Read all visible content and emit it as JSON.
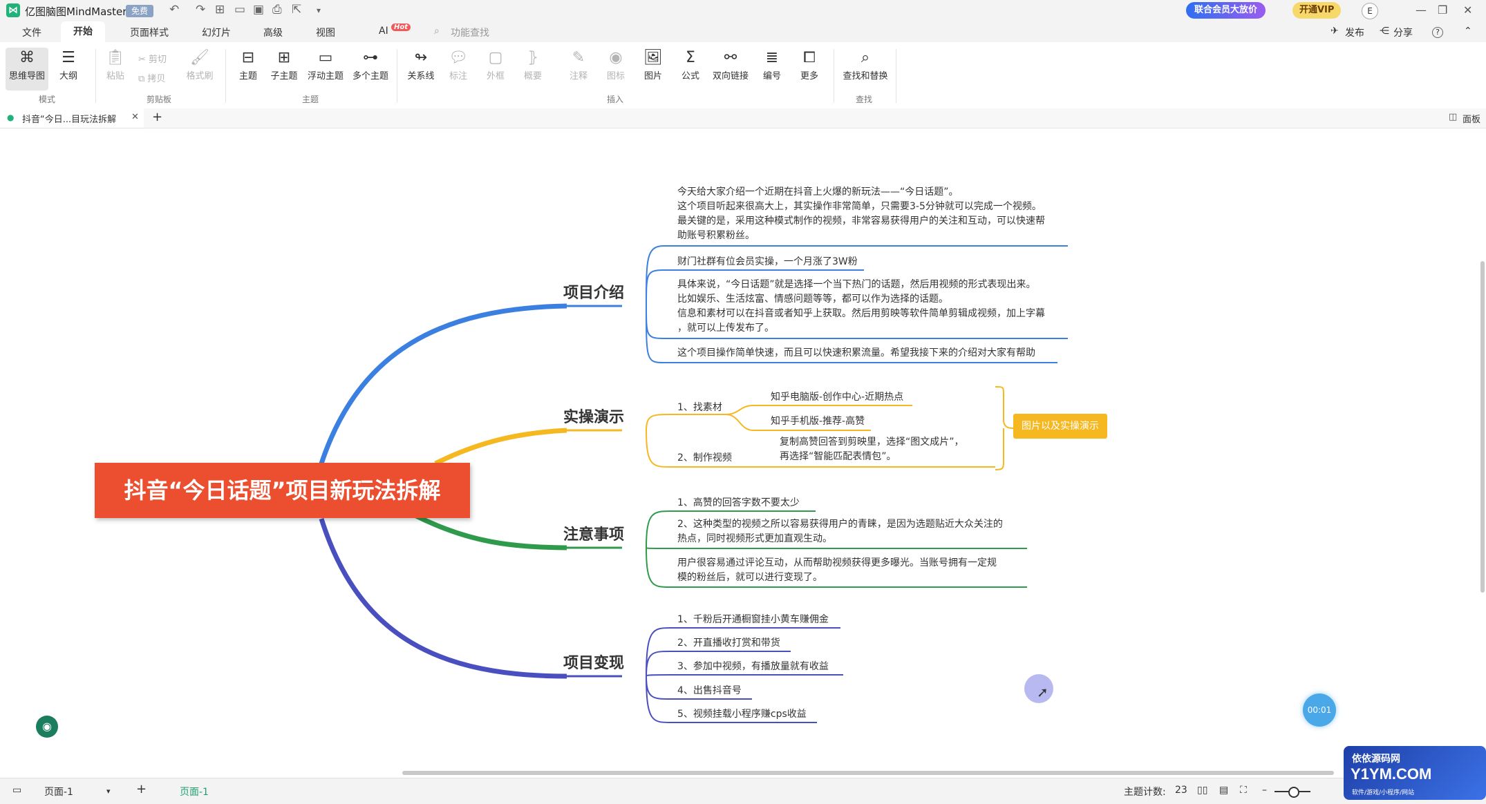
{
  "app": {
    "name": "亿图脑图MindMaster",
    "badge": "免费",
    "search_placeholder": "功能查找",
    "promo": "联合会员大放价",
    "vip": "开通VIP",
    "avatar": "E"
  },
  "menu": {
    "items": [
      "文件",
      "开始",
      "页面样式",
      "幻灯片",
      "高级",
      "视图",
      "AI"
    ],
    "active": "开始",
    "hot": "Hot",
    "publish": "发布",
    "share": "分享",
    "help": "?"
  },
  "ribbon": {
    "mode": [
      "思维导图",
      "大纲"
    ],
    "clipboard": [
      "粘贴",
      "剪切",
      "拷贝",
      "格式刷"
    ],
    "topic": [
      "主题",
      "子主题",
      "浮动主题",
      "多个主题"
    ],
    "insert": [
      "关系线",
      "标注",
      "外框",
      "概要",
      "注释",
      "图标",
      "图片",
      "公式",
      "双向链接",
      "编号",
      "更多"
    ],
    "find": [
      "查找和替换"
    ],
    "group_labels": [
      "模式",
      "剪贴板",
      "主题",
      "插入",
      "查找"
    ]
  },
  "tabs": {
    "doc_tab": "抖音“今日...目玩法拆解",
    "panel": "面板"
  },
  "mindmap": {
    "central": "抖音“今日话题”项目新玩法拆解",
    "branches": [
      {
        "title": "项目介绍",
        "color": "#3b7fe0",
        "items": [
          "今天给大家介绍一个近期在抖音上火爆的新玩法——“今日话题”。|这个项目听起来很高大上，其实操作非常简单，只需要3-5分钟就可以完成一个视频。|最关键的是，采用这种模式制作的视频，非常容易获得用户的关注和互动，可以快速帮|助账号积累粉丝。",
          "财门社群有位会员实操，一个月涨了3W粉",
          "具体来说，“今日话题”就是选择一个当下热门的话题，然后用视频的形式表现出来。|比如娱乐、生活炫富、情感问题等等，都可以作为选择的话题。|信息和素材可以在抖音或者知乎上获取。然后用剪映等软件简单剪辑成视频，加上字幕|，就可以上传发布了。",
          "这个项目操作简单快速，而且可以快速积累流量。希望我接下来的介绍对大家有帮助"
        ]
      },
      {
        "title": "实操演示",
        "color": "#f5b820",
        "items": [
          "1、找素材",
          "2、制作视频"
        ],
        "sub_items": [
          "知乎电脑版-创作中心-近期热点",
          "知乎手机版-推荐-高赞",
          "复制高赞回答到剪映里，选择“图文成片”，|再选择“智能匹配表情包”。"
        ],
        "callout": "图片以及实操演示"
      },
      {
        "title": "注意事项",
        "color": "#2f9a4c",
        "items": [
          "1、高赞的回答字数不要太少",
          "2、这种类型的视频之所以容易获得用户的青睐，是因为选题贴近大众关注的|热点，同时视频形式更加直观生动。",
          "用户很容易通过评论互动，从而帮助视频获得更多曝光。当账号拥有一定规|模的粉丝后，就可以进行变现了。"
        ]
      },
      {
        "title": "项目变现",
        "color": "#4a4fc0",
        "items": [
          "1、千粉后开通橱窗挂小黄车赚佣金",
          "2、开直播收打赏和带货",
          "3、参加中视频，有播放量就有收益",
          "4、出售抖音号",
          "5、视频挂载小程序赚cps收益"
        ]
      }
    ]
  },
  "status": {
    "page_select": "页面-1",
    "page_tab": "页面-1",
    "topic_count_label": "主题计数:",
    "topic_count": "23"
  },
  "overlay": {
    "timer": "00:01",
    "watermark_line1": "依依源码网",
    "watermark_line2": "Y1YM.COM",
    "watermark_line3": "软件/游戏/小程序/网站"
  }
}
